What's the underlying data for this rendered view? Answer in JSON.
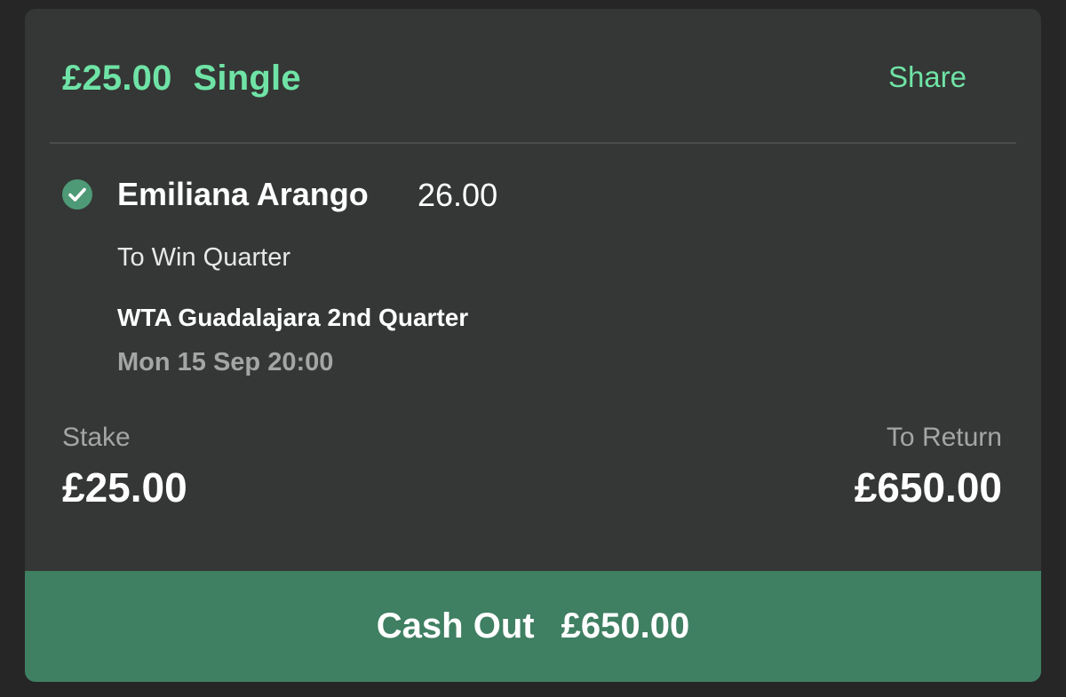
{
  "bet": {
    "stake_header": "£25.00",
    "type": "Single",
    "share_label": "Share"
  },
  "selection": {
    "name": "Emiliana Arango",
    "odds": "26.00",
    "market": "To Win Quarter",
    "event": "WTA Guadalajara 2nd Quarter",
    "datetime": "Mon 15 Sep 20:00",
    "status_icon": "check-circle-icon"
  },
  "summary": {
    "stake_label": "Stake",
    "stake_value": "£25.00",
    "return_label": "To Return",
    "return_value": "£650.00"
  },
  "cashout": {
    "label": "Cash Out",
    "amount": "£650.00"
  },
  "colors": {
    "accent": "#6fe3a6",
    "card_bg": "#343735",
    "cashout_bg": "#3f7f62",
    "check_bg": "#4e9a76"
  }
}
